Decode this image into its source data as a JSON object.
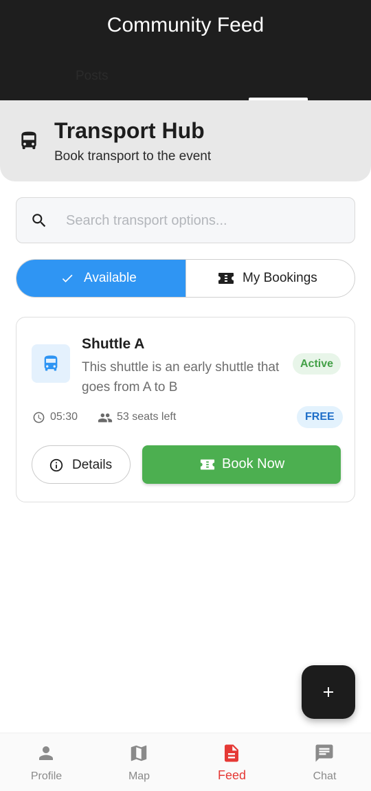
{
  "appbar": {
    "title": "Community Feed",
    "tab_label": "Posts"
  },
  "hub": {
    "title": "Transport Hub",
    "subtitle": "Book transport to the event",
    "icon": "bus-icon"
  },
  "search": {
    "placeholder": "Search transport options...",
    "value": ""
  },
  "toggle": {
    "available_label": "Available",
    "bookings_label": "My Bookings",
    "selected": "Available"
  },
  "transport": {
    "title": "Shuttle A",
    "description": "This shuttle is an early shuttle that goes from A to B",
    "status": "Active",
    "time": "05:30",
    "seats": "53 seats left",
    "price": "FREE",
    "details_label": "Details",
    "book_label": "Book Now"
  },
  "nav": {
    "items": [
      {
        "label": "Profile",
        "icon": "person-icon"
      },
      {
        "label": "Map",
        "icon": "map-icon"
      },
      {
        "label": "Feed",
        "icon": "feed-icon"
      },
      {
        "label": "Chat",
        "icon": "chat-icon"
      }
    ],
    "active": "Feed"
  },
  "colors": {
    "appbar": "#1e1e1e",
    "accent_blue": "#2f95f3",
    "book_green": "#4caf50",
    "active_nav": "#e53935",
    "status_green": "#43a047",
    "price_blue": "#1e6ec8"
  }
}
